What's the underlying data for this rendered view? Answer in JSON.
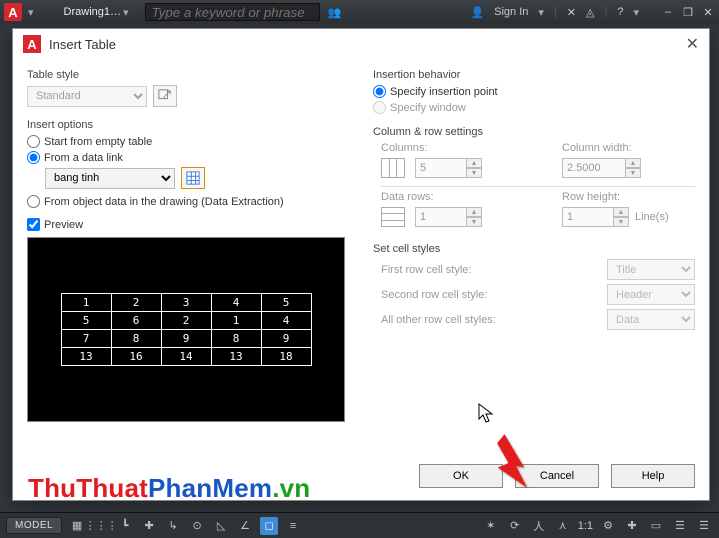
{
  "app": {
    "logo_letter": "A",
    "doc_title": "Drawing1…",
    "search_placeholder": "Type a keyword or phrase",
    "sign_in": "Sign In"
  },
  "dialog": {
    "title": "Insert Table",
    "table_style": {
      "label": "Table style",
      "value": "Standard"
    },
    "insert_options": {
      "label": "Insert options",
      "start_empty": "Start from empty table",
      "from_data_link": "From a data link",
      "data_link_value": "bang tinh",
      "from_object": "From object data in the drawing (Data Extraction)"
    },
    "preview_label": "Preview",
    "insertion_behavior": {
      "label": "Insertion behavior",
      "specify_point": "Specify insertion point",
      "specify_window": "Specify window"
    },
    "col_row": {
      "label": "Column & row settings",
      "columns_label": "Columns:",
      "columns_value": "5",
      "col_width_label": "Column width:",
      "col_width_value": "2.5000",
      "data_rows_label": "Data rows:",
      "data_rows_value": "1",
      "row_height_label": "Row height:",
      "row_height_value": "1",
      "lines_suffix": "Line(s)"
    },
    "cell_styles": {
      "label": "Set cell styles",
      "first_label": "First row cell style:",
      "first_value": "Title",
      "second_label": "Second row cell style:",
      "second_value": "Header",
      "other_label": "All other row cell styles:",
      "other_value": "Data"
    },
    "buttons": {
      "ok": "OK",
      "cancel": "Cancel",
      "help": "Help"
    }
  },
  "preview_data": [
    [
      "1",
      "2",
      "3",
      "4",
      "5"
    ],
    [
      "5",
      "6",
      "2",
      "1",
      "4"
    ],
    [
      "7",
      "8",
      "9",
      "8",
      "9"
    ],
    [
      "13",
      "16",
      "14",
      "13",
      "18"
    ]
  ],
  "statusbar": {
    "model": "MODEL",
    "scale": "1:1"
  },
  "watermark": {
    "p1": "ThuThuat",
    "p2": "PhanMem",
    "p3": ".vn"
  }
}
